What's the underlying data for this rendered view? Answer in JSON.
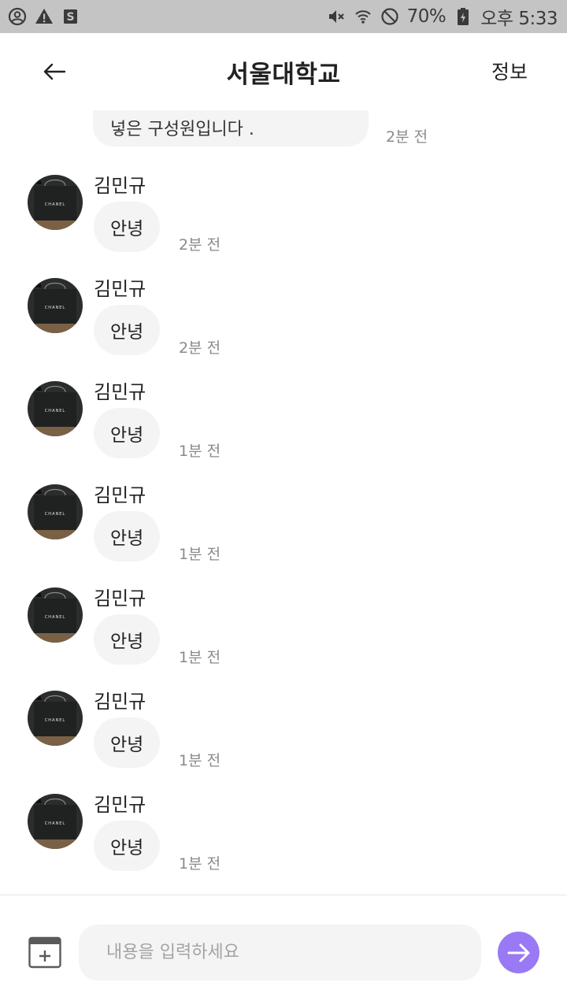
{
  "status_bar": {
    "battery": "70%",
    "time": "오후 5:33",
    "left_icons": [
      "account-icon",
      "warning-icon",
      "s-app-icon"
    ],
    "right_icons": [
      "mute-icon",
      "wifi-icon",
      "blocked-icon",
      "battery-charging-icon"
    ]
  },
  "header": {
    "back_icon": "arrow-left-icon",
    "title": "서울대학교",
    "info_label": "정보"
  },
  "messages": {
    "first": {
      "text": "넣은 구성원입니다 .",
      "time": "2분 전"
    },
    "items": [
      {
        "sender": "김민규",
        "text": "안녕",
        "time": "2분 전"
      },
      {
        "sender": "김민규",
        "text": "안녕",
        "time": "2분 전"
      },
      {
        "sender": "김민규",
        "text": "안녕",
        "time": "1분 전"
      },
      {
        "sender": "김민규",
        "text": "안녕",
        "time": "1분 전"
      },
      {
        "sender": "김민규",
        "text": "안녕",
        "time": "1분 전"
      },
      {
        "sender": "김민규",
        "text": "안녕",
        "time": "1분 전"
      },
      {
        "sender": "김민규",
        "text": "안녕",
        "time": "1분 전"
      }
    ],
    "avatar_label": "CHANEL"
  },
  "input": {
    "placeholder": "내용을 입력하세요",
    "value": "",
    "attach_icon": "calendar-add-icon",
    "send_icon": "arrow-right-icon"
  },
  "colors": {
    "status_bar_bg": "#c4c4c4",
    "bubble_bg": "#f4f4f4",
    "accent": "#9a79f5",
    "muted_text": "#8a8a8a"
  }
}
